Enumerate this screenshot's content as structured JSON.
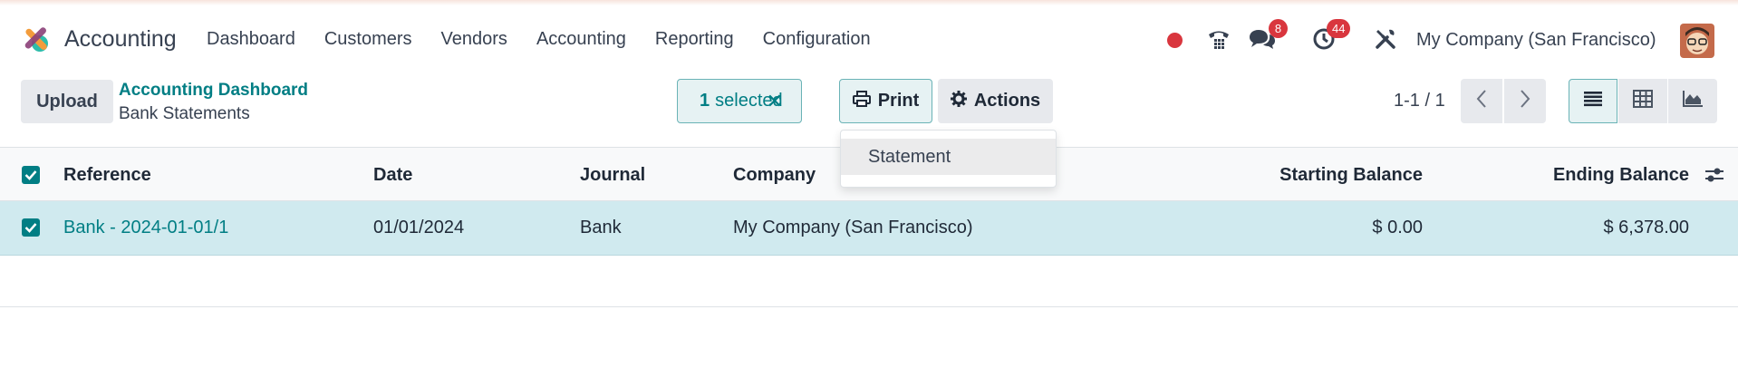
{
  "app": {
    "title": "Accounting",
    "colors": {
      "brand": "#017e84",
      "badge": "#d9363e",
      "selected_row": "#d0eaef"
    }
  },
  "navbar": {
    "menu": [
      "Dashboard",
      "Customers",
      "Vendors",
      "Accounting",
      "Reporting",
      "Configuration"
    ],
    "icons": [
      "record-icon",
      "phone-icon",
      "chat-icon",
      "activity-clock-icon",
      "tools-icon"
    ],
    "messages_badge": "8",
    "activities_badge": "44",
    "company": "My Company (San Francisco)"
  },
  "control_panel": {
    "upload_label": "Upload",
    "breadcrumb_parent": "Accounting Dashboard",
    "breadcrumb_current": "Bank Statements",
    "selected_count": "1",
    "selected_label": "selected",
    "print_label": "Print",
    "actions_label": "Actions",
    "pager_text": "1-1 / 1"
  },
  "print_menu": {
    "items": [
      "Statement"
    ]
  },
  "table": {
    "columns": [
      "Reference",
      "Date",
      "Journal",
      "Company",
      "Starting Balance",
      "Ending Balance"
    ],
    "rows": [
      {
        "reference": "Bank - 2024-01-01/1",
        "date": "01/01/2024",
        "journal": "Bank",
        "company": "My Company (San Francisco)",
        "starting_balance": "$ 0.00",
        "ending_balance": "$ 6,378.00",
        "selected": true
      }
    ]
  }
}
